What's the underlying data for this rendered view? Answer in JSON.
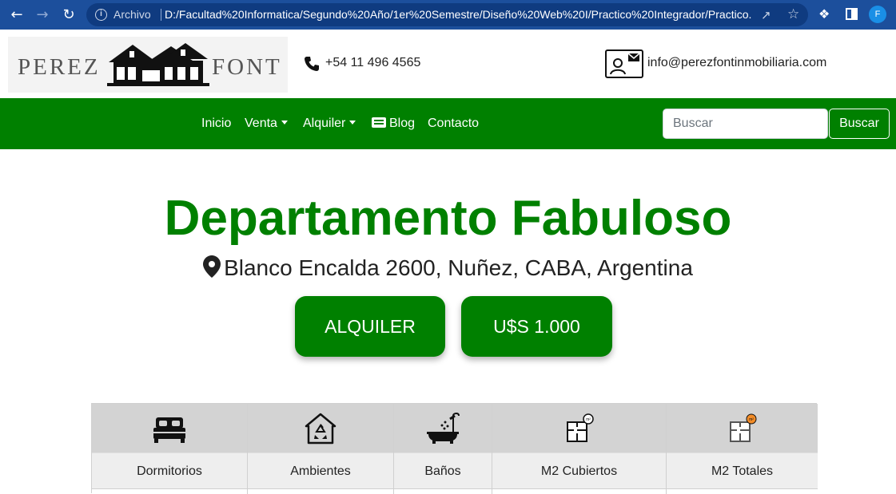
{
  "browser": {
    "scheme_label": "Archivo",
    "url": "D:/Facultad%20Informatica/Segundo%20Año/1er%20Semestre/Diseño%20Web%20I/Practico%20Integrador/Practico...",
    "profile_initial": "F",
    "icons": [
      "back-arrow-icon",
      "forward-arrow-icon",
      "reload-icon",
      "info-icon",
      "share-icon",
      "star-icon",
      "extensions-icon",
      "side-panel-icon"
    ]
  },
  "header": {
    "logo_left": "PEREZ",
    "logo_right": "FONT",
    "phone": "+54 11 496 4565",
    "email": "info@perezfontinmobiliaria.com"
  },
  "nav": {
    "items": [
      {
        "label": "Inicio",
        "dropdown": false
      },
      {
        "label": "Venta",
        "dropdown": true
      },
      {
        "label": "Alquiler",
        "dropdown": true
      },
      {
        "label": "Blog",
        "dropdown": false,
        "icon": "newspaper-icon"
      },
      {
        "label": "Contacto",
        "dropdown": false
      }
    ],
    "search_placeholder": "Buscar",
    "search_button": "Buscar"
  },
  "property": {
    "title": "Departamento Fabuloso",
    "address": "Blanco Encalda 2600, Nuñez, CABA, Argentina",
    "operation": "ALQUILER",
    "price": "U$S 1.000"
  },
  "features": [
    {
      "label": "Dormitorios",
      "icon": "bed-icon"
    },
    {
      "label": "Ambientes",
      "icon": "house-recycle-icon"
    },
    {
      "label": "Baños",
      "icon": "bathtub-icon"
    },
    {
      "label": "M2 Cubiertos",
      "icon": "floorplan-icon"
    },
    {
      "label": "M2 Totales",
      "icon": "floorplan-total-icon"
    }
  ],
  "colors": {
    "brand_green": "#008000",
    "browser_bar": "#1c4f9c",
    "table_icon_bg": "#d3d3d3",
    "table_label_bg": "#eeeeee"
  }
}
